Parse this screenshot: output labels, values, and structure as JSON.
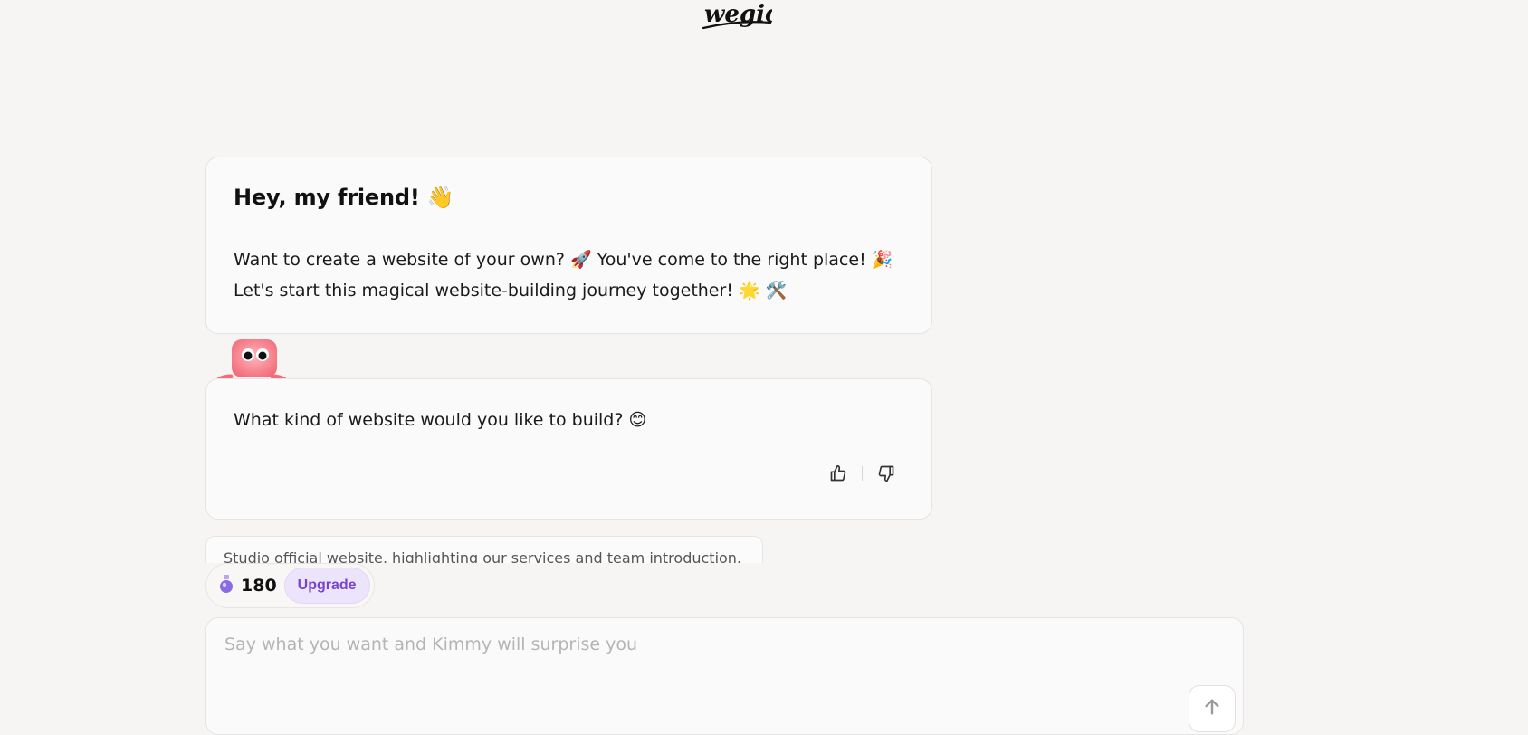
{
  "brand": {
    "logo_text": "wegic"
  },
  "greeting": {
    "title": "Hey, my friend! 👋",
    "body": "Want to create a website of your own? 🚀 You've come to the right place! 🎉 Let's start this magical website-building journey together! 🌟 🛠️"
  },
  "assistant_message": {
    "text": "What kind of website would you like to build? 😊",
    "feedback": {
      "like_icon": "thumbs-up-icon",
      "dislike_icon": "thumbs-down-icon"
    }
  },
  "suggestion": {
    "text": "Studio official website, highlighting our services and team introduction."
  },
  "credits": {
    "icon": "potion-icon",
    "count": "180",
    "upgrade_label": "Upgrade"
  },
  "composer": {
    "placeholder": "Say what you want and Kimmy will surprise you",
    "value": "",
    "send_icon": "arrow-up-icon"
  },
  "colors": {
    "background": "#f6f5f4",
    "upgrade_accent": "#7744d0",
    "upgrade_bg": "#ece4fb",
    "mascot": "#f7727f"
  }
}
